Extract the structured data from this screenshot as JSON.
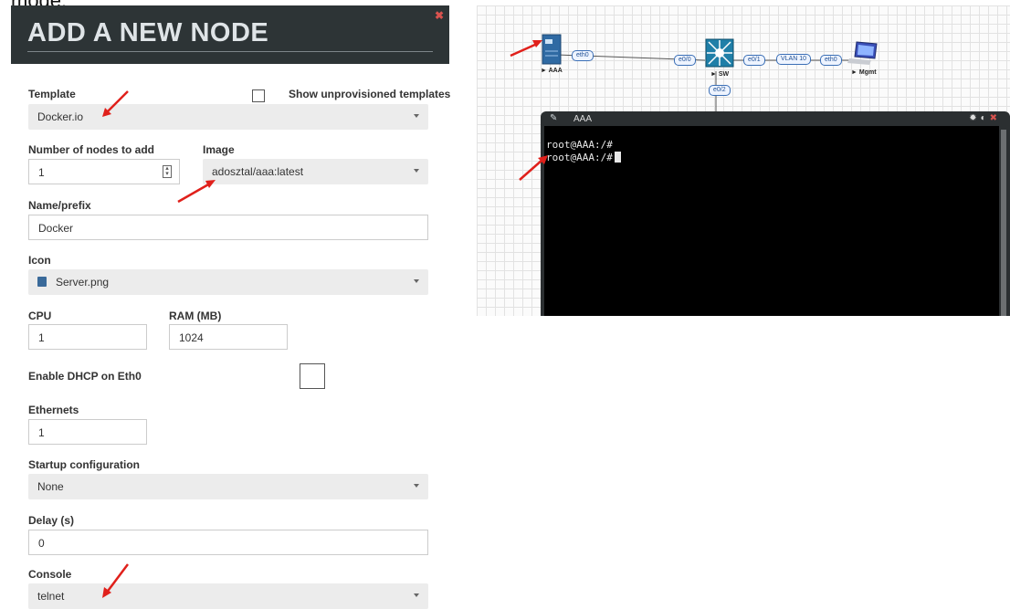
{
  "top_cut_text": "mode.",
  "dialog": {
    "title": "ADD A NEW NODE",
    "close_icon": "close-icon",
    "template": {
      "label": "Template",
      "value": "Docker.io"
    },
    "show_unprovisioned": {
      "label": "Show unprovisioned templates",
      "checked": false
    },
    "nodes_to_add": {
      "label": "Number of nodes to add",
      "value": "1"
    },
    "image": {
      "label": "Image",
      "value": "adosztal/aaa:latest"
    },
    "name_prefix": {
      "label": "Name/prefix",
      "value": "Docker"
    },
    "icon": {
      "label": "Icon",
      "value": "Server.png"
    },
    "cpu": {
      "label": "CPU",
      "value": "1"
    },
    "ram": {
      "label": "RAM (MB)",
      "value": "1024"
    },
    "dhcp": {
      "label": "Enable DHCP on Eth0",
      "checked": false
    },
    "ethernets": {
      "label": "Ethernets",
      "value": "1"
    },
    "startup": {
      "label": "Startup configuration",
      "value": "None"
    },
    "delay": {
      "label": "Delay (s)",
      "value": "0"
    },
    "console": {
      "label": "Console",
      "value": "telnet"
    }
  },
  "topology": {
    "nodes": [
      {
        "label": "AAA",
        "icon": "server-icon"
      },
      {
        "label": "SW",
        "icon": "switch-icon"
      },
      {
        "label": "Mgmt",
        "icon": "computer-icon"
      }
    ],
    "interfaces": {
      "aaa_eth0": "eth0",
      "sw_e00": "e0/0",
      "sw_e01": "e0/1",
      "sw_e02": "e0/2",
      "vlan": "VLAN 10",
      "mgmt_eth0": "eth0"
    }
  },
  "terminal": {
    "title": "AAA",
    "lines": [
      "root@AAA:/#",
      "root@AAA:/#"
    ]
  },
  "colors": {
    "dialog_header": "#2d3436",
    "annotation_arrow": "#e0201b",
    "terminal_bg": "#000000"
  }
}
